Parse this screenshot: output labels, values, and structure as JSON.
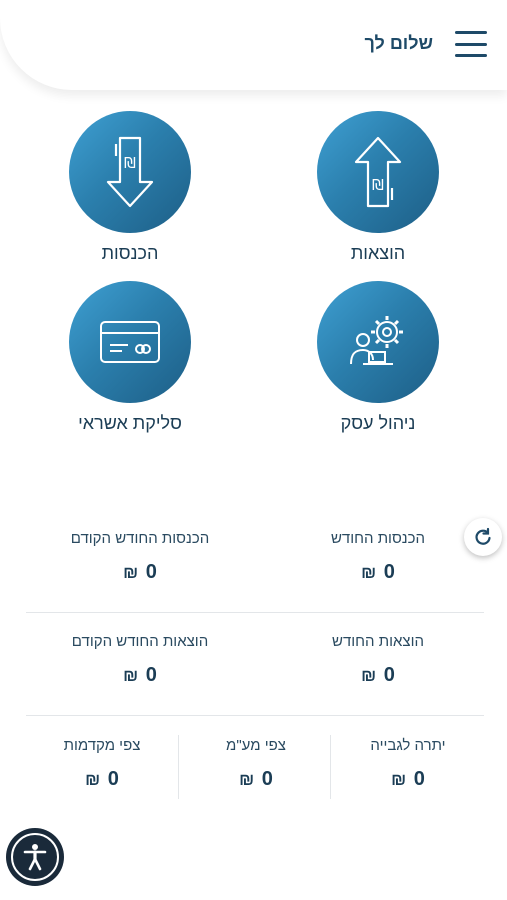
{
  "header": {
    "greeting": "שלום לך"
  },
  "tiles": [
    {
      "label": "הוצאות",
      "icon": "expense-arrow-up-icon"
    },
    {
      "label": "הכנסות",
      "icon": "income-arrow-down-icon"
    },
    {
      "label": "ניהול עסק",
      "icon": "business-gear-icon"
    },
    {
      "label": "סליקת אשראי",
      "icon": "credit-card-icon"
    }
  ],
  "stats": {
    "income_this_month": {
      "label": "הכנסות החודש",
      "value": "0",
      "currency": "₪"
    },
    "income_prev_month": {
      "label": "הכנסות החודש הקודם",
      "value": "0",
      "currency": "₪"
    },
    "expenses_this_month": {
      "label": "הוצאות החודש",
      "value": "0",
      "currency": "₪"
    },
    "expenses_prev_month": {
      "label": "הוצאות החודש הקודם",
      "value": "0",
      "currency": "₪"
    },
    "balance_due": {
      "label": "יתרה לגבייה",
      "value": "0",
      "currency": "₪"
    },
    "expected_vat": {
      "label": "צפי מע\"מ",
      "value": "0",
      "currency": "₪"
    },
    "expected_advances": {
      "label": "צפי מקדמות",
      "value": "0",
      "currency": "₪"
    }
  },
  "colors": {
    "accent": "#2b7fad",
    "text": "#1b3d55"
  }
}
